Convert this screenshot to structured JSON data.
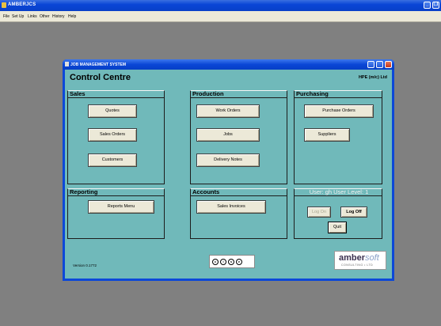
{
  "app": {
    "title": "AMBERJCS",
    "menu": [
      "File",
      "Set Up",
      "Links",
      "Other",
      "History",
      "Help"
    ]
  },
  "window": {
    "title": "JOB MANAGEMENT SYSTEM",
    "heading": "Control Centre",
    "company": "HPE (m/c) Ltd"
  },
  "sections": {
    "sales": {
      "title": "Sales",
      "buttons": [
        "Quotes",
        "Sales Orders",
        "Customers"
      ]
    },
    "production": {
      "title": "Production",
      "buttons": [
        "Work Orders",
        "Jobs",
        "Delivery Notes"
      ]
    },
    "purchasing": {
      "title": "Purchasing",
      "buttons": [
        "Purchase Orders",
        "Suppliers"
      ]
    },
    "reporting": {
      "title": "Reporting",
      "buttons": [
        "Reports Menu"
      ]
    },
    "accounts": {
      "title": "Accounts",
      "buttons": [
        "Sales Invoices"
      ]
    },
    "user": {
      "title": "User: gh  User Level: 1",
      "log_on": "Log On",
      "log_off": "Log Off",
      "quit": "Quit"
    }
  },
  "footer": {
    "version": "Version 0.1772",
    "cc_letters": [
      "c",
      "i",
      "s",
      "e"
    ],
    "amber_logo": "amber",
    "amber_logo_soft": "soft",
    "amber_sub": "CONSULTING • LTD"
  },
  "colors": {
    "accent": "#0a46d6",
    "body_bg": "#70b9ba",
    "button_bg": "#ece9d8"
  }
}
